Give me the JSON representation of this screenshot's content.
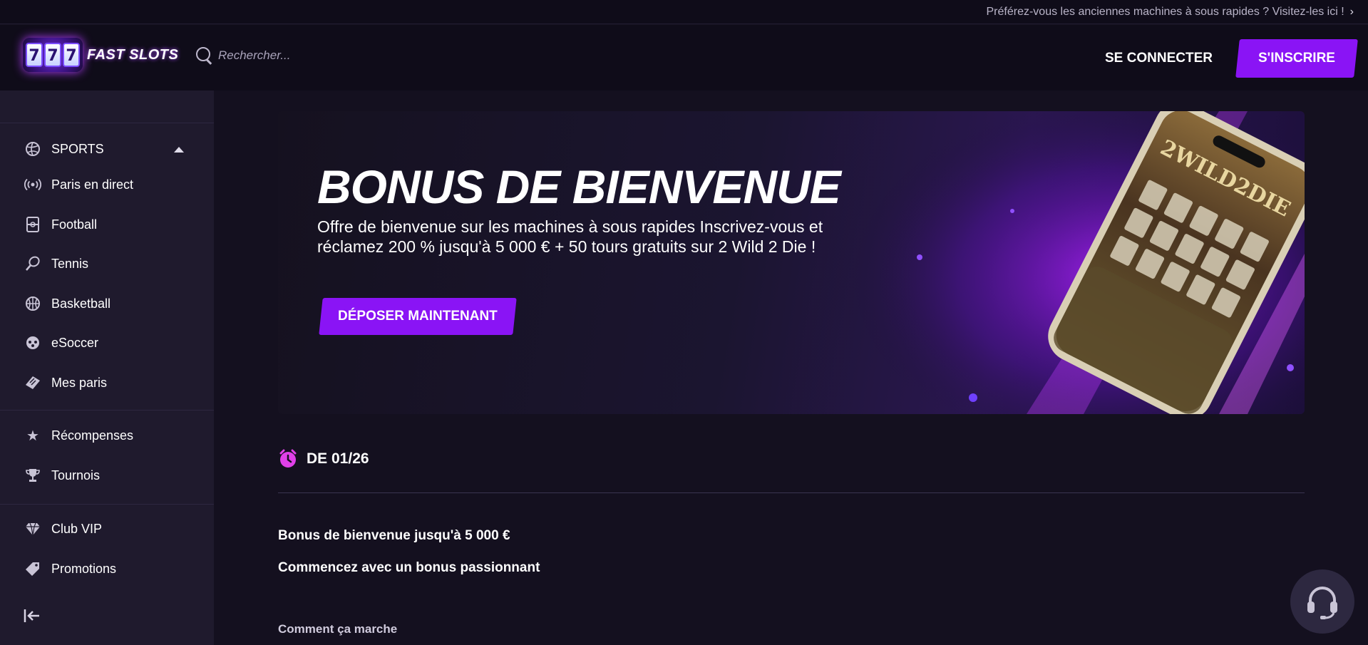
{
  "topstrip": {
    "text": "Préférez-vous les anciennes machines à sous rapides ? Visitez-les ici !",
    "chevron": "›"
  },
  "header": {
    "logo_digits": [
      "7",
      "7",
      "7"
    ],
    "logo_text": "FAST SLOTS",
    "search_placeholder": "Rechercher...",
    "login_label": "SE CONNECTER",
    "signup_label": "S'INSCRIRE"
  },
  "sidebar": {
    "sports_label": "SPORTS",
    "sports_items": [
      {
        "label": "Paris en direct",
        "icon": "live-broadcast-icon"
      },
      {
        "label": "Football",
        "icon": "football-pitch-icon"
      },
      {
        "label": "Tennis",
        "icon": "tennis-racket-icon"
      },
      {
        "label": "Basketball",
        "icon": "basketball-icon"
      },
      {
        "label": "eSoccer",
        "icon": "gamepad-icon"
      },
      {
        "label": "Mes paris",
        "icon": "ticket-icon"
      }
    ],
    "section2": [
      {
        "label": "Récompenses",
        "icon": "star-icon"
      },
      {
        "label": "Tournois",
        "icon": "trophy-icon"
      }
    ],
    "section3": [
      {
        "label": "Club VIP",
        "icon": "diamond-icon"
      },
      {
        "label": "Promotions",
        "icon": "tag-icon"
      }
    ]
  },
  "banner": {
    "title": "BONUS DE BIENVENUE",
    "description": "Offre de bienvenue sur les machines à sous rapides Inscrivez-vous et réclamez 200 % jusqu'à 5 000 € + 50 tours gratuits sur 2 Wild 2 Die !",
    "cta_label": "DÉPOSER MAINTENANT",
    "game_name": "2WILD2DIE"
  },
  "promo": {
    "date_label": "DE 01/26",
    "line1": "Bonus de bienvenue jusqu'à 5 000 €",
    "line2": "Commencez avec un bonus passionnant",
    "section_heading": "Comment ça marche"
  },
  "colors": {
    "accent": "#8a14f5",
    "clock": "#e040e8",
    "background": "#14101f",
    "sidebar": "#1f1a2d"
  }
}
